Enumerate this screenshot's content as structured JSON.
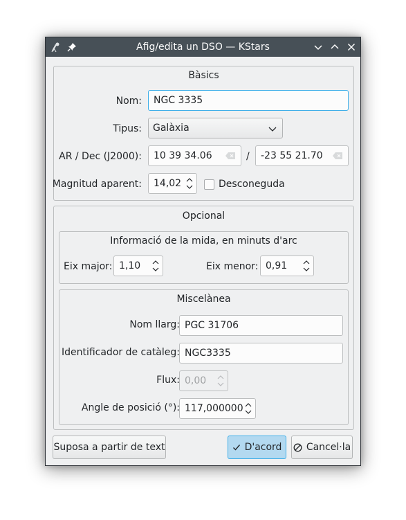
{
  "window": {
    "title": "Afig/edita un DSO — KStars"
  },
  "basics": {
    "title": "Bàsics",
    "name_label": "Nom:",
    "name_value": "NGC 3335",
    "type_label": "Tipus:",
    "type_value": "Galàxia",
    "radec_label": "AR / Dec (J2000):",
    "ra_value": "10 39 34.06",
    "separator": "/",
    "dec_value": "-23 55 21.70",
    "magnitude_label": "Magnitud aparent:",
    "magnitude_value": "14,02",
    "unknown_label": "Desconeguda"
  },
  "optional": {
    "title": "Opcional",
    "size": {
      "title": "Informació de la mida, en minuts d'arc",
      "major_label": "Eix major:",
      "major_value": "1,10",
      "minor_label": "Eix menor:",
      "minor_value": "0,91"
    },
    "misc": {
      "title": "Miscelànea",
      "long_name_label": "Nom llarg:",
      "long_name_value": "PGC 31706",
      "catalog_id_label": "Identificador de catàleg:",
      "catalog_id_value": "NGC3335",
      "flux_label": "Flux:",
      "flux_value": "0,00",
      "position_angle_label": "Angle de posició (°):",
      "position_angle_value": "117,000000"
    }
  },
  "buttons": {
    "guess_label": "Suposa a partir de text",
    "ok_label": "D'acord",
    "cancel_label": "Cancel·la"
  },
  "colors": {
    "titlebar": "#475057",
    "window": "#eff0f1",
    "focus": "#3daee9",
    "primary_button": "#b3d9f0"
  },
  "icons": [
    "kstars-icon",
    "pin-icon",
    "minimize-icon",
    "maximize-icon",
    "close-icon",
    "clear-icon",
    "spin-arrows-icon",
    "check-icon",
    "cancel-icon",
    "chevron-down-icon"
  ]
}
